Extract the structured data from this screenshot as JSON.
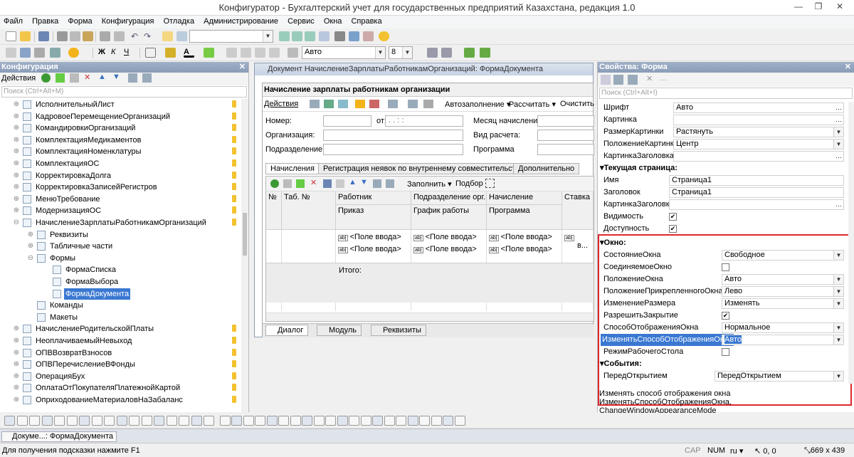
{
  "window": {
    "title": "Конфигуратор - Бухгалтерский учет для государственных предприятий Казахстана, редакция 1.0"
  },
  "menu": [
    "Файл",
    "Правка",
    "Форма",
    "Конфигурация",
    "Отладка",
    "Администрирование",
    "Сервис",
    "Окна",
    "Справка"
  ],
  "toolbar2": {
    "font": "Авто",
    "size": "8"
  },
  "left_panel": {
    "title": "Конфигурация",
    "actions": "Действия",
    "search_placeholder": "Поиск (Ctrl+Alt+M)",
    "items": [
      {
        "label": "ИсполнительныйЛист",
        "level": 1,
        "exp": "+"
      },
      {
        "label": "КадровоеПеремещениеОрганизаций",
        "level": 1,
        "exp": "+"
      },
      {
        "label": "КомандировкиОрганизаций",
        "level": 1,
        "exp": "+"
      },
      {
        "label": "КомплектацияМедикаментов",
        "level": 1,
        "exp": "+"
      },
      {
        "label": "КомплектацияНоменклатуры",
        "level": 1,
        "exp": "+"
      },
      {
        "label": "КомплектацияОС",
        "level": 1,
        "exp": "+"
      },
      {
        "label": "КорректировкаДолга",
        "level": 1,
        "exp": "+"
      },
      {
        "label": "КорректировкаЗаписейРегистров",
        "level": 1,
        "exp": "+"
      },
      {
        "label": "МенюТребование",
        "level": 1,
        "exp": "+"
      },
      {
        "label": "МодернизацияОС",
        "level": 1,
        "exp": "+"
      },
      {
        "label": "НачислениеЗарплатыРаботникамОрганизаций",
        "level": 1,
        "exp": "−"
      },
      {
        "label": "Реквизиты",
        "level": 2,
        "exp": "+"
      },
      {
        "label": "Табличные части",
        "level": 2,
        "exp": "+"
      },
      {
        "label": "Формы",
        "level": 2,
        "exp": "−"
      },
      {
        "label": "ФормаСписка",
        "level": 3,
        "exp": ""
      },
      {
        "label": "ФормаВыбора",
        "level": 3,
        "exp": ""
      },
      {
        "label": "ФормаДокумента",
        "level": 3,
        "exp": "",
        "selected": true
      },
      {
        "label": "Команды",
        "level": 2,
        "exp": ""
      },
      {
        "label": "Макеты",
        "level": 2,
        "exp": ""
      },
      {
        "label": "НачислениеРодительскойПлаты",
        "level": 1,
        "exp": "+"
      },
      {
        "label": "НеоплачиваемыйНевыход",
        "level": 1,
        "exp": "+"
      },
      {
        "label": "ОПВВозвратВзносов",
        "level": 1,
        "exp": "+"
      },
      {
        "label": "ОПВПеречислениеВФонды",
        "level": 1,
        "exp": "+"
      },
      {
        "label": "ОперацияБух",
        "level": 1,
        "exp": "+"
      },
      {
        "label": "ОплатаОтПокупателяПлатежнойКартой",
        "level": 1,
        "exp": "+"
      },
      {
        "label": "ОприходованиеМатериаловНаЗабаланс",
        "level": 1,
        "exp": "+"
      }
    ]
  },
  "center": {
    "window_title": "Документ НачислениеЗарплатыРаботникамОрганизаций: ФормаДокумента",
    "form_title": "Начисление зарплаты работникам организации",
    "toolbar": {
      "actions": "Действия",
      "autofill": "Автозаполнение",
      "calc": "Рассчитать",
      "clear": "Очистить"
    },
    "labels": {
      "number": "Номер:",
      "from": "от:",
      "date_mask": ". .   : :",
      "month": "Месяц начисления:",
      "org": "Организация:",
      "calc_type": "Вид расчета:",
      "dept": "Подразделение:",
      "program": "Программа"
    },
    "tabs": [
      "Начисления",
      "Регистрация неявок по внутреннему совместительству",
      "Дополнительно"
    ],
    "grid_toolbar": {
      "fill": "Заполнить",
      "select": "Подбор"
    },
    "columns": [
      "№",
      "Таб. №",
      "Работник",
      "Подразделение орг...",
      "Начисление",
      "Ставка"
    ],
    "columns2": [
      "Приказ",
      "График работы",
      "Программа"
    ],
    "field": "<Поле ввода>",
    "cut_field": "в...",
    "total": "Итого:",
    "bottom_tabs": [
      "Диалог",
      "Модуль",
      "Реквизиты"
    ]
  },
  "right_panel": {
    "title": "Свойства: Форма",
    "search_placeholder": "Поиск (Ctrl+Alt+I)",
    "props1": [
      {
        "name": "Шрифт",
        "value": "Авто"
      },
      {
        "name": "Картинка",
        "value": ""
      },
      {
        "name": "РазмерКартинки",
        "value": "Растянуть"
      },
      {
        "name": "ПоложениеКартинки",
        "value": "Центр"
      },
      {
        "name": "КартинкаЗаголовка",
        "value": ""
      }
    ],
    "sec_page": "Текущая страница:",
    "props2": [
      {
        "name": "Имя",
        "value": "Страница1"
      },
      {
        "name": "Заголовок",
        "value": "Страница1"
      },
      {
        "name": "КартинкаЗаголовка",
        "value": ""
      },
      {
        "name": "Видимость",
        "value": "✔"
      },
      {
        "name": "Доступность",
        "value": "✔"
      }
    ],
    "sec_window": "Окно:",
    "props3": [
      {
        "name": "СостояниеОкна",
        "value": "Свободное"
      },
      {
        "name": "СоединяемоеОкно",
        "value": ""
      },
      {
        "name": "ПоложениеОкна",
        "value": "Авто"
      },
      {
        "name": "ПоложениеПрикрепленногоОкна",
        "value": "Лево"
      },
      {
        "name": "ИзменениеРазмера",
        "value": "Изменять"
      },
      {
        "name": "РазрешитьЗакрытие",
        "value": "✔"
      },
      {
        "name": "СпособОтображенияОкна",
        "value": "Нормальное"
      },
      {
        "name": "ИзменятьСпособОтображенияОкна",
        "value": "Авто"
      },
      {
        "name": "РежимРабочегоСтола",
        "value": ""
      }
    ],
    "sec_events": "События:",
    "event": {
      "name": "ПередОткрытием",
      "value": "ПередОткрытием"
    },
    "help1": "Изменять способ отображения окна",
    "help2": "ИзменятьСпособОтображенияОкна, ChangeWindowAppearanceMode"
  },
  "taskbar": {
    "item": "Докуме...: ФормаДокумента"
  },
  "status": {
    "hint": "Для получения подсказки нажмите F1",
    "cap": "CAP",
    "num": "NUM",
    "lang": "ru",
    "pos": "0, 0",
    "size": "669 x 439"
  },
  "colors": {
    "accent_red": "#e0282e",
    "selection": "#3a78d2"
  }
}
